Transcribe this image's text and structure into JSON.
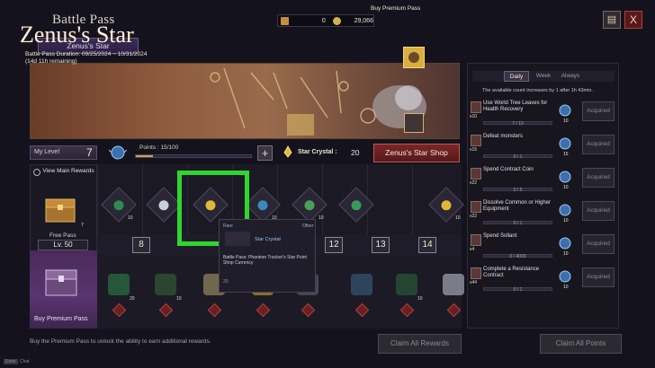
{
  "header": {
    "title": "Battle Pass",
    "pass_tab": "Zenus's Star",
    "currency_a": "0",
    "currency_b": "29,066",
    "book_icon": "book-icon",
    "close_label": "X"
  },
  "banner": {
    "title": "Zenus's Star",
    "duration": "Battle Pass Duration: 09/25/2024 ~ 10/31/2024",
    "remaining": "(14d 11h remaining)",
    "buy_premium": "Buy Premium Pass"
  },
  "level_bar": {
    "label": "My Level",
    "value": "7",
    "points": "Points : 15/100",
    "points_fraction": 0.15,
    "plus": "+",
    "crystal_label": "Star Crystal :",
    "crystal_value": "20",
    "shop_button": "Zenus's Star Shop"
  },
  "left_col": {
    "view_main_rewards": "View Main Rewards",
    "free_pass": "Free Pass",
    "free_count": "7",
    "level_label": "Lv. 50",
    "buy_premium": "Buy Premium Pass"
  },
  "track": {
    "levels": [
      "8",
      "12",
      "13",
      "14"
    ],
    "free_counts": [
      "10",
      "",
      "",
      "10",
      "10",
      "",
      "10"
    ],
    "premium_counts": [
      "20",
      "10",
      "",
      "",
      "",
      "",
      "10"
    ]
  },
  "tooltip": {
    "rarity": "Rare",
    "type": "Other",
    "name": "Star Crystal",
    "description": "Battle Pass: Phantom Tracker's Star Point Shop Currency",
    "count": "20"
  },
  "missions_panel": {
    "tabs": [
      "Daily",
      "Week",
      "Always"
    ],
    "note": "The available count increases by 1 after 1h 43min.",
    "missions": [
      {
        "title": "Use World Tree Leaves for Health Recovery",
        "mult": "x10",
        "progress": "7 / 10",
        "reward": "10",
        "button": "Acquired"
      },
      {
        "title": "Defeat monsters",
        "mult": "x15",
        "progress": "0 / 1",
        "reward": "15",
        "button": "Acquired"
      },
      {
        "title": "Spend Contract Coin",
        "mult": "x22",
        "progress": "0 / 5",
        "reward": "10",
        "button": "Acquired"
      },
      {
        "title": "Dissolve Common or Higher Equipment",
        "mult": "x22",
        "progress": "0 / 1",
        "reward": "10",
        "button": "Acquired"
      },
      {
        "title": "Spend Sollant",
        "mult": "x4",
        "progress": "0 / 4000",
        "reward": "10",
        "button": "Acquired"
      },
      {
        "title": "Complete a Resistance Contract",
        "mult": "x44",
        "progress": "0 / 1",
        "reward": "10",
        "button": "Acquired"
      }
    ]
  },
  "bottom": {
    "note": "Buy the Premium Pass to unlock the ability to earn additional rewards.",
    "claim_rewards": "Claim All Rewards",
    "claim_points": "Claim All Points",
    "chat_key": "Enter",
    "chat": "Chat"
  },
  "colors": {
    "highlight": "#2fd62f",
    "accent_gold": "#c9a84c",
    "shop_red": "#7a2628",
    "premium_purple": "#5a3470"
  }
}
